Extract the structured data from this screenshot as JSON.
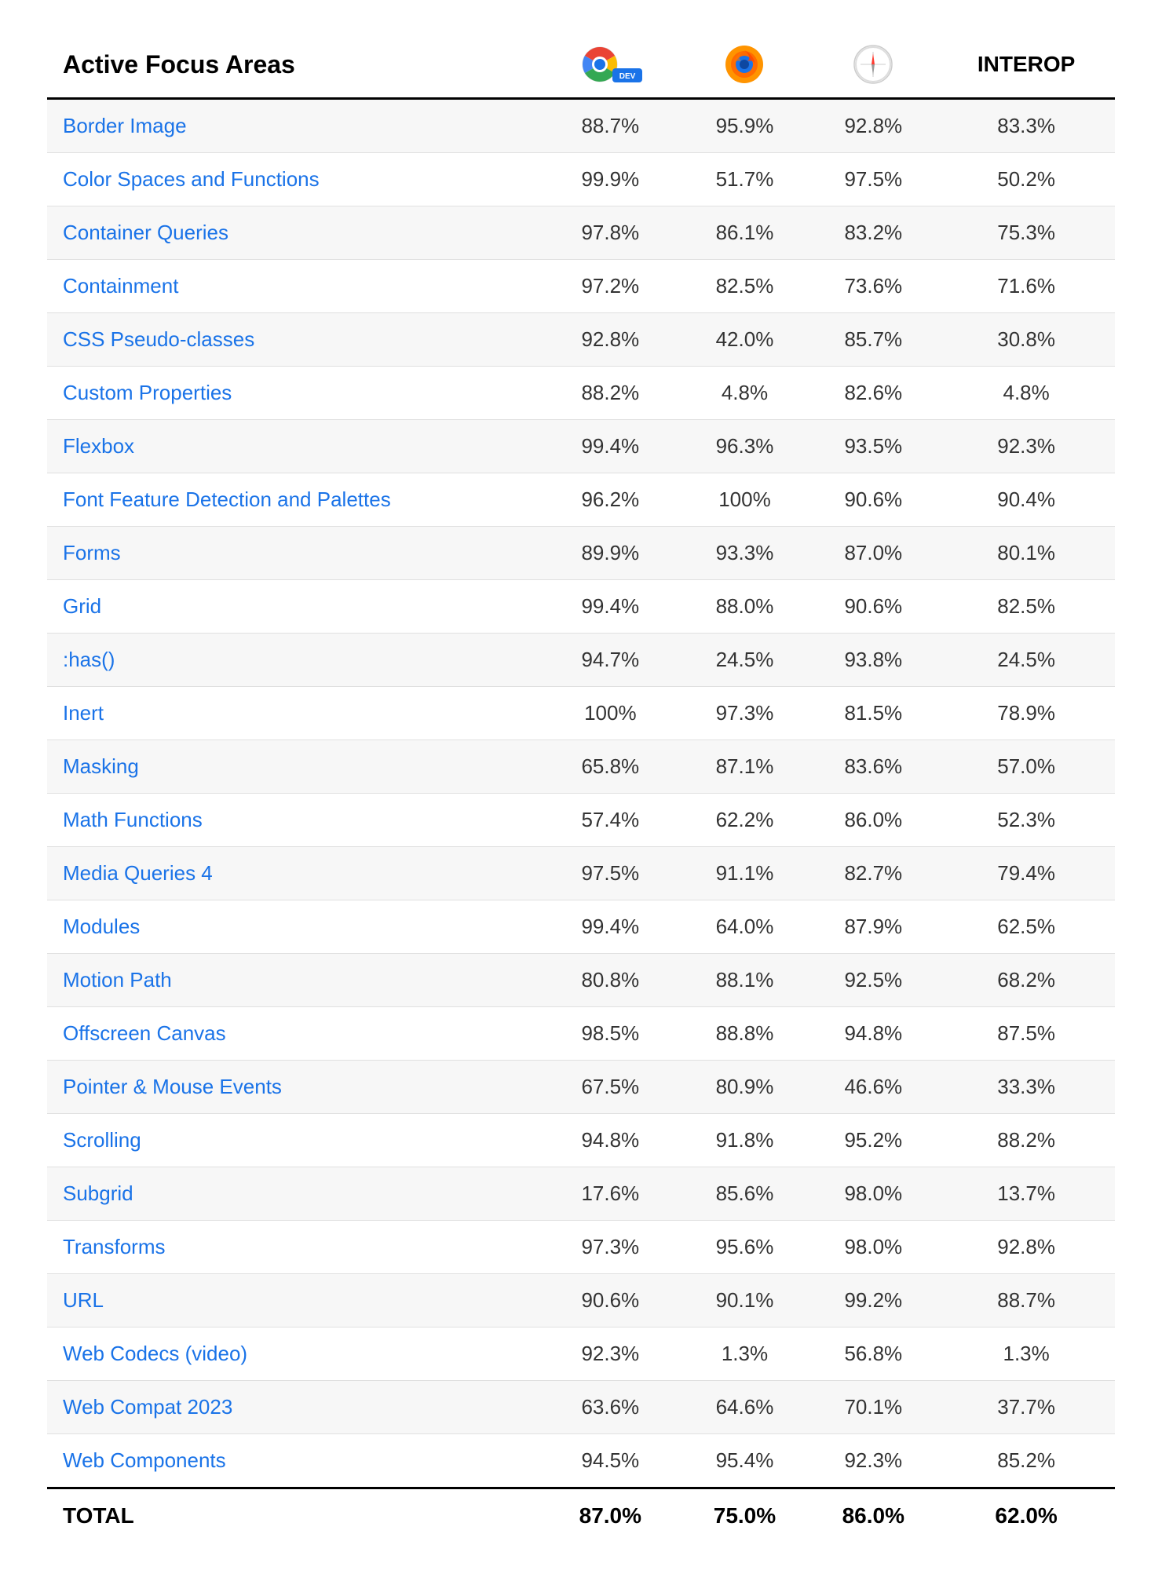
{
  "header": {
    "col_name": "Active Focus Areas",
    "col_interop": "INTEROP",
    "col_chrome_label": "Chrome Dev",
    "col_firefox_label": "Firefox",
    "col_safari_label": "Safari"
  },
  "rows": [
    {
      "name": "Border Image",
      "chrome": "88.7%",
      "firefox": "95.9%",
      "safari": "92.8%",
      "interop": "83.3%"
    },
    {
      "name": "Color Spaces and Functions",
      "chrome": "99.9%",
      "firefox": "51.7%",
      "safari": "97.5%",
      "interop": "50.2%"
    },
    {
      "name": "Container Queries",
      "chrome": "97.8%",
      "firefox": "86.1%",
      "safari": "83.2%",
      "interop": "75.3%"
    },
    {
      "name": "Containment",
      "chrome": "97.2%",
      "firefox": "82.5%",
      "safari": "73.6%",
      "interop": "71.6%"
    },
    {
      "name": "CSS Pseudo-classes",
      "chrome": "92.8%",
      "firefox": "42.0%",
      "safari": "85.7%",
      "interop": "30.8%"
    },
    {
      "name": "Custom Properties",
      "chrome": "88.2%",
      "firefox": "4.8%",
      "safari": "82.6%",
      "interop": "4.8%"
    },
    {
      "name": "Flexbox",
      "chrome": "99.4%",
      "firefox": "96.3%",
      "safari": "93.5%",
      "interop": "92.3%"
    },
    {
      "name": "Font Feature Detection and Palettes",
      "chrome": "96.2%",
      "firefox": "100%",
      "safari": "90.6%",
      "interop": "90.4%"
    },
    {
      "name": "Forms",
      "chrome": "89.9%",
      "firefox": "93.3%",
      "safari": "87.0%",
      "interop": "80.1%"
    },
    {
      "name": "Grid",
      "chrome": "99.4%",
      "firefox": "88.0%",
      "safari": "90.6%",
      "interop": "82.5%"
    },
    {
      "name": ":has()",
      "chrome": "94.7%",
      "firefox": "24.5%",
      "safari": "93.8%",
      "interop": "24.5%"
    },
    {
      "name": "Inert",
      "chrome": "100%",
      "firefox": "97.3%",
      "safari": "81.5%",
      "interop": "78.9%"
    },
    {
      "name": "Masking",
      "chrome": "65.8%",
      "firefox": "87.1%",
      "safari": "83.6%",
      "interop": "57.0%"
    },
    {
      "name": "Math Functions",
      "chrome": "57.4%",
      "firefox": "62.2%",
      "safari": "86.0%",
      "interop": "52.3%"
    },
    {
      "name": "Media Queries 4",
      "chrome": "97.5%",
      "firefox": "91.1%",
      "safari": "82.7%",
      "interop": "79.4%"
    },
    {
      "name": "Modules",
      "chrome": "99.4%",
      "firefox": "64.0%",
      "safari": "87.9%",
      "interop": "62.5%"
    },
    {
      "name": "Motion Path",
      "chrome": "80.8%",
      "firefox": "88.1%",
      "safari": "92.5%",
      "interop": "68.2%"
    },
    {
      "name": "Offscreen Canvas",
      "chrome": "98.5%",
      "firefox": "88.8%",
      "safari": "94.8%",
      "interop": "87.5%"
    },
    {
      "name": "Pointer & Mouse Events",
      "chrome": "67.5%",
      "firefox": "80.9%",
      "safari": "46.6%",
      "interop": "33.3%"
    },
    {
      "name": "Scrolling",
      "chrome": "94.8%",
      "firefox": "91.8%",
      "safari": "95.2%",
      "interop": "88.2%"
    },
    {
      "name": "Subgrid",
      "chrome": "17.6%",
      "firefox": "85.6%",
      "safari": "98.0%",
      "interop": "13.7%"
    },
    {
      "name": "Transforms",
      "chrome": "97.3%",
      "firefox": "95.6%",
      "safari": "98.0%",
      "interop": "92.8%"
    },
    {
      "name": "URL",
      "chrome": "90.6%",
      "firefox": "90.1%",
      "safari": "99.2%",
      "interop": "88.7%"
    },
    {
      "name": "Web Codecs (video)",
      "chrome": "92.3%",
      "firefox": "1.3%",
      "safari": "56.8%",
      "interop": "1.3%"
    },
    {
      "name": "Web Compat 2023",
      "chrome": "63.6%",
      "firefox": "64.6%",
      "safari": "70.1%",
      "interop": "37.7%"
    },
    {
      "name": "Web Components",
      "chrome": "94.5%",
      "firefox": "95.4%",
      "safari": "92.3%",
      "interop": "85.2%"
    }
  ],
  "footer": {
    "name": "TOTAL",
    "chrome": "87.0%",
    "firefox": "75.0%",
    "safari": "86.0%",
    "interop": "62.0%"
  }
}
